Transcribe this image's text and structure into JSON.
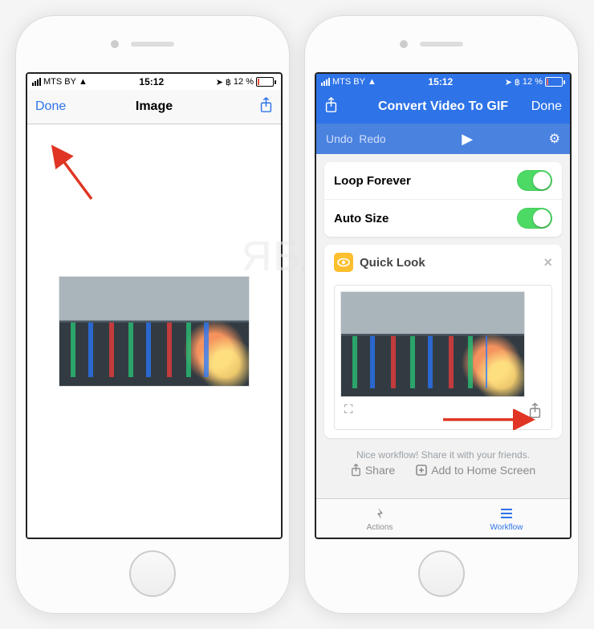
{
  "status": {
    "carrier": "MTS BY",
    "time": "15:12",
    "battery_pct": "12 %"
  },
  "left": {
    "done": "Done",
    "title": "Image"
  },
  "right": {
    "title": "Convert Video To GIF",
    "done": "Done",
    "undo": "Undo",
    "redo": "Redo",
    "toggles": {
      "loop": "Loop Forever",
      "auto": "Auto Size"
    },
    "quicklook": "Quick Look",
    "hint": "Nice workflow! Share it with your friends.",
    "share": "Share",
    "add_home": "Add to Home Screen",
    "tabs": {
      "actions": "Actions",
      "workflow": "Workflow"
    }
  },
  "watermark": "ЯБЛЫК"
}
